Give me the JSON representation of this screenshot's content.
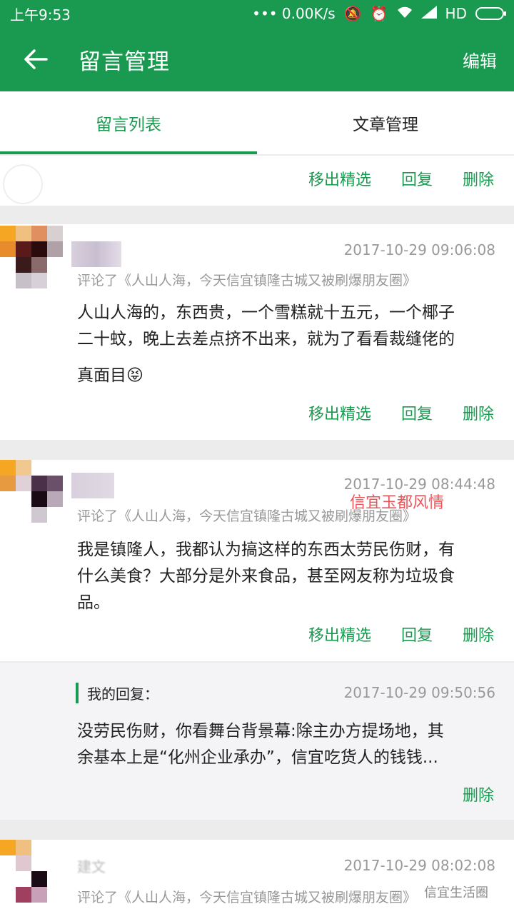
{
  "status_bar": {
    "time": "上午9:53",
    "network": "••• 0.00K/s",
    "carrier": "HD"
  },
  "app_bar": {
    "title": "留言管理",
    "edit": "编辑"
  },
  "tabs": [
    {
      "label": "留言列表",
      "active": true
    },
    {
      "label": "文章管理",
      "active": false
    }
  ],
  "actions": {
    "remove_featured": "移出精选",
    "reply": "回复",
    "delete": "删除"
  },
  "comments": [
    {
      "timestamp": "2017-10-29 09:06:08",
      "ref": "评论了《人山人海，今天信宜镇隆古城又被刷爆朋友圈》",
      "line1": "人山人海的，东西贵，一个雪糕就十五元，一个椰子",
      "line2": "二十蚊，晚上去差点挤不出来，就为了看看裁缝佬的",
      "line3": "真面目😝"
    },
    {
      "timestamp": "2017-10-29 08:44:48",
      "ref": "评论了《人山人海，今天信宜镇隆古城又被刷爆朋友圈》",
      "line1": "我是镇隆人，我都认为搞这样的东西太劳民伤财，有",
      "line2": "什么美食？大部分是外来食品，甚至网友称为垃圾食",
      "line3": "品。"
    },
    {
      "name": "建文",
      "timestamp": "2017-10-29 08:02:08",
      "ref": "评论了《人山人海，今天信宜镇隆古城又被刷爆朋友圈》"
    }
  ],
  "my_reply": {
    "label": "我的回复：",
    "timestamp": "2017-10-29 09:50:56",
    "line1": "没劳民伤财，你看舞台背景幕:除主办方提场地，其",
    "line2": "余基本上是“化州企业承办”，信宜吃货人的钱钱...",
    "delete": "删除"
  },
  "watermarks": {
    "center": "信宜玉都风情",
    "corner": "信宜生活圈"
  },
  "colors": {
    "brand_green": "#1a9a50",
    "muted_gray": "#999999"
  }
}
